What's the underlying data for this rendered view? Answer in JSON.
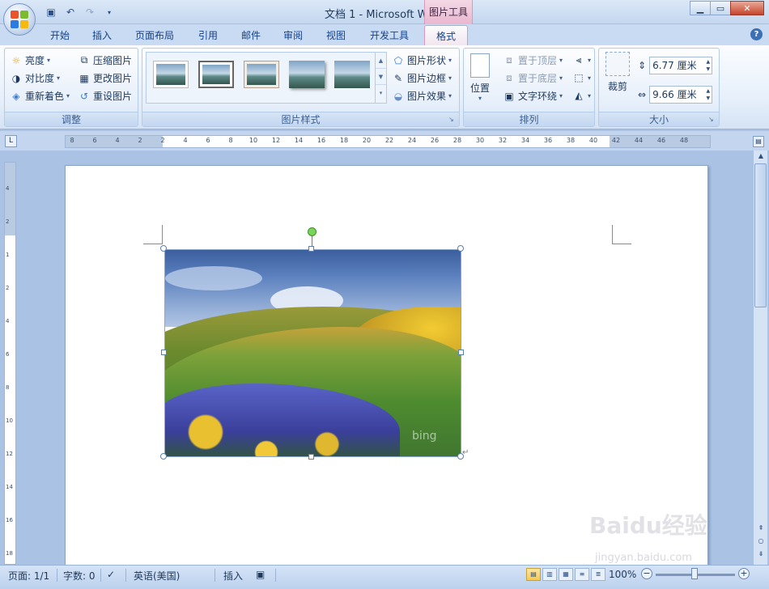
{
  "window": {
    "title": "文档 1 - Microsoft Word",
    "context_tab_group": "图片工具"
  },
  "tabs": [
    "开始",
    "插入",
    "页面布局",
    "引用",
    "邮件",
    "审阅",
    "视图",
    "开发工具",
    "格式"
  ],
  "active_tab": "格式",
  "ribbon": {
    "adjust": {
      "label": "调整",
      "brightness": "亮度",
      "contrast": "对比度",
      "recolor": "重新着色",
      "compress": "压缩图片",
      "change_picture": "更改图片",
      "reset_picture": "重设图片"
    },
    "picture_styles": {
      "label": "图片样式",
      "shape": "图片形状",
      "border": "图片边框",
      "effects": "图片效果"
    },
    "arrange": {
      "label": "排列",
      "position": "位置",
      "bring_front": "置于顶层",
      "send_back": "置于底层",
      "text_wrap": "文字环绕"
    },
    "size": {
      "label": "大小",
      "crop": "裁剪",
      "height": "6.77 厘米",
      "width": "9.66 厘米"
    }
  },
  "ruler": {
    "ticks": [
      "8",
      "6",
      "4",
      "2",
      "2",
      "4",
      "6",
      "8",
      "10",
      "12",
      "14",
      "16",
      "18",
      "20",
      "22",
      "24",
      "26",
      "28",
      "30",
      "32",
      "34",
      "36",
      "38",
      "40",
      "42",
      "44",
      "46",
      "48"
    ]
  },
  "vruler": {
    "ticks": [
      "4",
      "2",
      "1",
      "2",
      "4",
      "6",
      "8",
      "10",
      "12",
      "14",
      "16",
      "18"
    ]
  },
  "picture": {
    "watermark": "bing"
  },
  "status": {
    "page": "页面: 1/1",
    "words": "字数: 0",
    "language": "英语(美国)",
    "mode": "插入",
    "zoom": "100%"
  },
  "watermark": {
    "line1": "Baidu经验",
    "line2": "jingyan.baidu.com"
  }
}
